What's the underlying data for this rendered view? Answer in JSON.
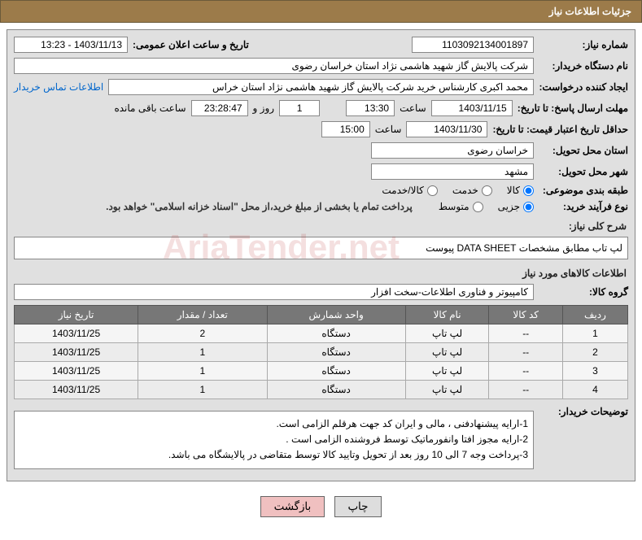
{
  "header": {
    "title": "جزئیات اطلاعات نیاز"
  },
  "labels": {
    "need_no": "شماره نیاز:",
    "announce_dt": "تاریخ و ساعت اعلان عمومی:",
    "buyer_org": "نام دستگاه خریدار:",
    "requester": "ایجاد کننده درخواست:",
    "contact_link": "اطلاعات تماس خریدار",
    "response_deadline": "مهلت ارسال پاسخ: تا تاریخ:",
    "hour": "ساعت",
    "days_and": "روز و",
    "remaining": "ساعت باقی مانده",
    "price_validity": "حداقل تاریخ اعتبار قیمت: تا تاریخ:",
    "delivery_province": "استان محل تحویل:",
    "delivery_city": "شهر محل تحویل:",
    "category": "طبقه بندی موضوعی:",
    "purchase_type": "نوع فرآیند خرید:",
    "payment_note": "پرداخت تمام یا بخشی از مبلغ خرید،از محل \"اسناد خزانه اسلامی\" خواهد بود.",
    "general_desc": "شرح کلی نیاز:",
    "goods_info": "اطلاعات کالاهای مورد نیاز",
    "goods_group": "گروه کالا:",
    "buyer_notes": "توضیحات خریدار:",
    "print": "چاپ",
    "back": "بازگشت"
  },
  "fields": {
    "need_no": "1103092134001897",
    "announce_dt": "1403/11/13 - 13:23",
    "buyer_org": "شرکت پالایش گاز شهید هاشمی نژاد   استان خراسان رضوی",
    "requester": "محمد اکبری کارشناس خرید شرکت پالایش گاز شهید هاشمی نژاد   استان خراس",
    "response_date": "1403/11/15",
    "response_time": "13:30",
    "remaining_days": "1",
    "remaining_time": "23:28:47",
    "validity_date": "1403/11/30",
    "validity_time": "15:00",
    "province": "خراسان رضوی",
    "city": "مشهد",
    "general_desc": "لپ تاب مطابق مشخصات DATA SHEET پیوست",
    "goods_group": "کامپیوتر و فناوری اطلاعات-سخت افزار"
  },
  "radios": {
    "cat_goods": "کالا",
    "cat_service": "خدمت",
    "cat_both": "کالا/خدمت",
    "pt_partial": "جزیی",
    "pt_medium": "متوسط"
  },
  "table": {
    "headers": {
      "row": "ردیف",
      "code": "کد کالا",
      "name": "نام کالا",
      "unit": "واحد شمارش",
      "qty": "تعداد / مقدار",
      "date": "تاریخ نیاز"
    },
    "rows": [
      {
        "row": "1",
        "code": "--",
        "name": "لپ تاپ",
        "unit": "دستگاه",
        "qty": "2",
        "date": "1403/11/25"
      },
      {
        "row": "2",
        "code": "--",
        "name": "لپ تاپ",
        "unit": "دستگاه",
        "qty": "1",
        "date": "1403/11/25"
      },
      {
        "row": "3",
        "code": "--",
        "name": "لپ تاپ",
        "unit": "دستگاه",
        "qty": "1",
        "date": "1403/11/25"
      },
      {
        "row": "4",
        "code": "--",
        "name": "لپ تاپ",
        "unit": "دستگاه",
        "qty": "1",
        "date": "1403/11/25"
      }
    ]
  },
  "notes": {
    "n1": "1-ارایه پیشنهادفنی ، مالی و ایران کد جهت هرقلم الزامی است.",
    "n2": "2-ارایه مجوز افتا وانفورماتیک توسط فروشنده الزامی است .",
    "n3": "3-پرداخت وجه 7 الی 10 روز بعد از تحویل وتایید کالا توسط متقاضی در پالایشگاه می باشد."
  },
  "watermark": "AriaTender.net"
}
